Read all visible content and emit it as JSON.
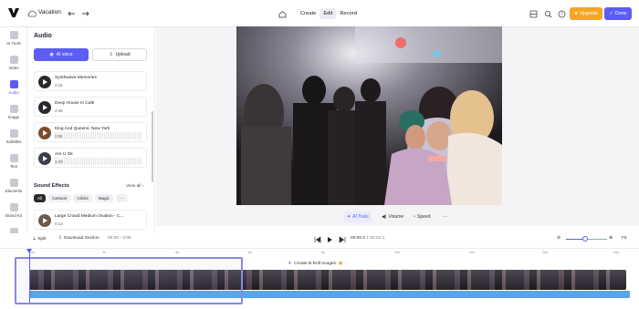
{
  "header": {
    "project_title": "Vacation",
    "modes": [
      "Create",
      "Edit",
      "Record"
    ],
    "active_mode": "Edit",
    "upgrade_label": "Upgrade",
    "done_label": "Done",
    "accent_color": "#5b5ef0",
    "upgrade_color": "#f5a623"
  },
  "leftnav": {
    "items": [
      {
        "label": "AI Tools",
        "icon": "ai-tools-icon"
      },
      {
        "label": "Video",
        "icon": "video-icon"
      },
      {
        "label": "Audio",
        "icon": "audio-icon"
      },
      {
        "label": "Image",
        "icon": "image-icon"
      },
      {
        "label": "Subtitles",
        "icon": "subtitles-icon"
      },
      {
        "label": "Text",
        "icon": "text-icon"
      },
      {
        "label": "Elements",
        "icon": "elements-icon"
      },
      {
        "label": "Brand Kit",
        "icon": "brand-kit-icon"
      },
      {
        "label": "Settings",
        "icon": "settings-icon"
      }
    ],
    "active": "Audio"
  },
  "panel": {
    "title": "Audio",
    "ai_voice_label": "AI voice",
    "upload_label": "Upload",
    "tracks": [
      {
        "name": "Synthwave Memories",
        "duration": "2:16"
      },
      {
        "name": "Deep House In Cafe",
        "duration": "4:48"
      },
      {
        "name": "King And Queens, New York",
        "duration": "2:06"
      },
      {
        "name": "Are U Ok",
        "duration": "1:29"
      }
    ],
    "sound_effects": {
      "title": "Sound Effects",
      "view_all": "View all",
      "chips": [
        "All",
        "Cartoon",
        "Clicks",
        "Magic"
      ],
      "active_chip": "All",
      "items": [
        {
          "name": "Large Crowd Medium Ovation - C...",
          "duration": "0:12"
        }
      ]
    }
  },
  "preview": {
    "controls": [
      "AI Tools",
      "Volume",
      "Speed"
    ],
    "active_control": "AI Tools"
  },
  "timeline": {
    "split_label": "Split",
    "download_label": "Download Section",
    "section_range": "00:00 - 2:05",
    "current_time": "00:00.0",
    "separator": "/",
    "total_time": "02:01.1",
    "fit_label": "Fit",
    "broll_label": "Create B-Roll Images",
    "ruler_marks": [
      "0s",
      "2s",
      "4s",
      "6s",
      "8s",
      "10s",
      "12s",
      "14s",
      "16s"
    ]
  }
}
